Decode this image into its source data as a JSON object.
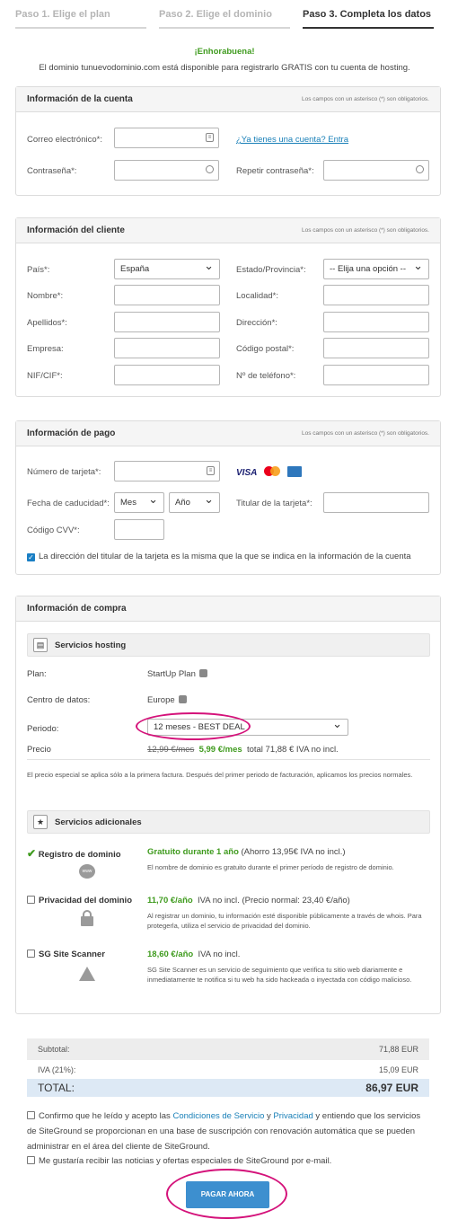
{
  "steps": [
    "Paso 1. Elige el plan",
    "Paso 2. Elige el dominio",
    "Paso 3. Completa los datos"
  ],
  "congrats": "¡Enhorabuena!",
  "domain_msg": "El dominio tunuevodominio.com está disponible para registrarlo GRATIS con tu cuenta de hosting.",
  "required_note": "Los campos con un asterisco (*) son obligatorios.",
  "account": {
    "title": "Información de la cuenta",
    "email": "Correo electrónico*:",
    "have_account": "¿Ya tienes una cuenta? Entra",
    "password": "Contraseña*:",
    "repeat": "Repetir contraseña*:"
  },
  "client": {
    "title": "Información del cliente",
    "country": "País*:",
    "country_val": "España",
    "state": "Estado/Provincia*:",
    "state_val": "-- Elija una opción --",
    "name": "Nombre*:",
    "city": "Localidad*:",
    "surname": "Apellidos*:",
    "address": "Dirección*:",
    "company": "Empresa:",
    "zip": "Código postal*:",
    "nif": "NIF/CIF*:",
    "phone": "Nº de teléfono*:"
  },
  "payment": {
    "title": "Información de pago",
    "card": "Número de tarjeta*:",
    "expiry": "Fecha de caducidad*:",
    "month": "Mes",
    "year": "Año",
    "holder": "Titular de la tarjeta*:",
    "cvv": "Código CVV*:",
    "same_address": "La dirección del titular de la tarjeta es la misma que la que se indica en la información de la cuenta",
    "visa": "VISA"
  },
  "purchase": {
    "title": "Información de compra",
    "hosting": "Servicios hosting",
    "plan_lbl": "Plan:",
    "plan_val": "StartUp Plan",
    "dc_lbl": "Centro de datos:",
    "dc_val": "Europe",
    "period_lbl": "Periodo:",
    "period_val": "12 meses - BEST DEAL",
    "price_lbl": "Precio",
    "price_old": "12,99 €/mes",
    "price_new": "5,99 €/mes",
    "price_total": "total 71,88 € IVA no incl.",
    "note": "El precio especial se aplica sólo a la primera factura. Después del primer periodo de facturación, aplicamos los precios normales.",
    "extras": "Servicios adicionales",
    "reg_name": "Registro de dominio",
    "reg_price": "Gratuito durante 1 año",
    "reg_note": "(Ahorro 13,95€ IVA no incl.)",
    "reg_desc": "El nombre de dominio es gratuito durante el primer período de registro de dominio.",
    "www": "www",
    "priv_name": "Privacidad del dominio",
    "priv_price": "11,70 €/año",
    "priv_note": "IVA no incl. (Precio normal: 23,40 €/año)",
    "priv_desc": "Al registrar un dominio, tu información esté disponible públicamente a través de whois. Para protegerla, utiliza el servicio de privacidad del dominio.",
    "scan_name": "SG Site Scanner",
    "scan_price": "18,60 €/año",
    "scan_note": "IVA no incl.",
    "scan_desc": "SG Site Scanner es un servicio de seguimiento que verifica tu sitio web diariamente e inmediatamente te notifica si tu web ha sido hackeada o inyectada con código malicioso."
  },
  "totals": {
    "subtotal_lbl": "Subtotal:",
    "subtotal": "71,88 EUR",
    "iva_lbl": "IVA (21%):",
    "iva": "15,09 EUR",
    "total_lbl": "TOTAL:",
    "total": "86,97 EUR"
  },
  "terms": {
    "a": "Confirmo que he leído y acepto las ",
    "tos": "Condiciones de Servicio",
    "y": " y ",
    "priv": "Privacidad",
    "b": " y entiendo que los servicios de SiteGround se proporcionan en una base de suscripción con renovación automática que se pueden administrar en el área del cliente de SiteGround.",
    "news": "Me gustaría recibir las noticias y ofertas especiales de SiteGround por e-mail."
  },
  "pay_button": "PAGAR AHORA"
}
